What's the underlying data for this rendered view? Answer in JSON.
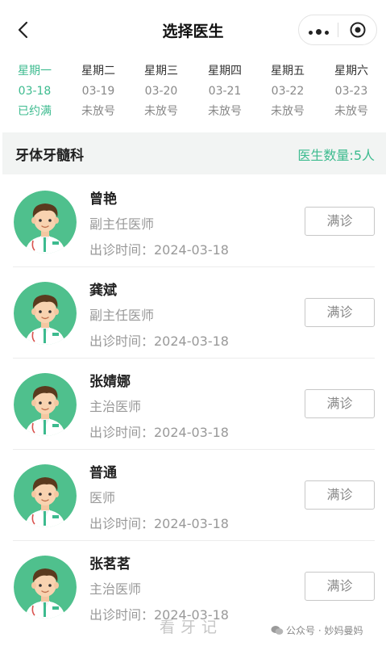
{
  "header": {
    "title": "选择医生",
    "back_icon": "chevron-left-icon",
    "more_icon": "more-dots-icon",
    "close_icon": "target-circle-icon"
  },
  "days": [
    {
      "name": "星期一",
      "date": "03-18",
      "status": "已约满",
      "active": true
    },
    {
      "name": "星期二",
      "date": "03-19",
      "status": "未放号",
      "active": false
    },
    {
      "name": "星期三",
      "date": "03-20",
      "status": "未放号",
      "active": false
    },
    {
      "name": "星期四",
      "date": "03-21",
      "status": "未放号",
      "active": false
    },
    {
      "name": "星期五",
      "date": "03-22",
      "status": "未放号",
      "active": false
    },
    {
      "name": "星期六",
      "date": "03-23",
      "status": "未放号",
      "active": false
    }
  ],
  "department": {
    "name": "牙体牙髓科",
    "count_label": "医生数量:5人"
  },
  "doctors": [
    {
      "name": "曾艳",
      "title": "副主任医师",
      "time": "出诊时间：2024-03-18",
      "status": "满诊"
    },
    {
      "name": "龚斌",
      "title": "副主任医师",
      "time": "出诊时间：2024-03-18",
      "status": "满诊"
    },
    {
      "name": "张婧娜",
      "title": "主治医师",
      "time": "出诊时间：2024-03-18",
      "status": "满诊"
    },
    {
      "name": "普通",
      "title": "医师",
      "time": "出诊时间：2024-03-18",
      "status": "满诊"
    },
    {
      "name": "张茗茗",
      "title": "主治医师",
      "time": "出诊时间：2024-03-18",
      "status": "满诊"
    }
  ],
  "footer": {
    "watermark": "看牙记",
    "wechat_label": "公众号 · 妙妈曼妈"
  },
  "colors": {
    "accent": "#3dbb8f",
    "avatar_bg": "#4fc08d"
  }
}
